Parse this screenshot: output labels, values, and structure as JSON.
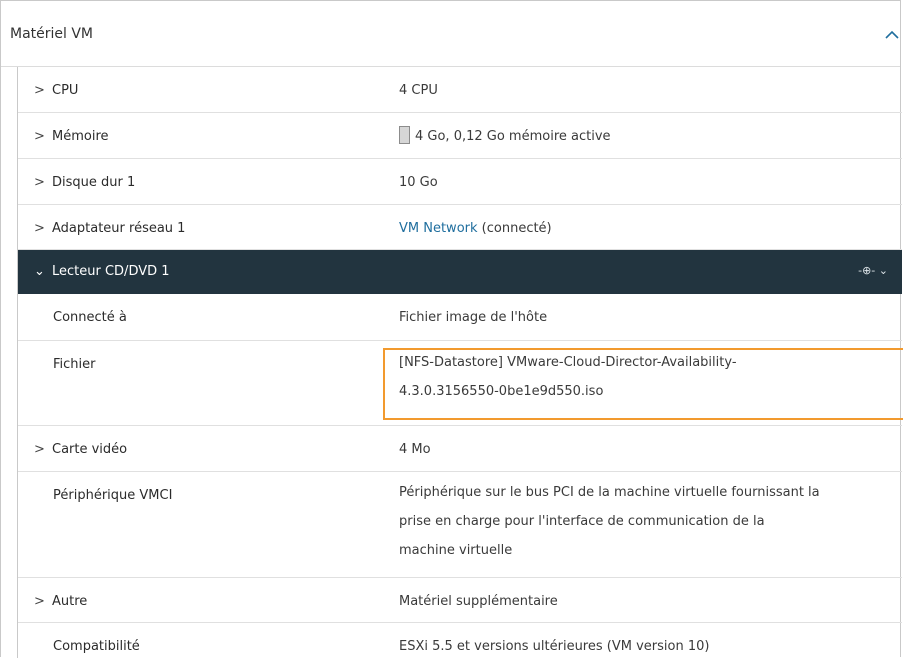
{
  "header": {
    "title": "Matériel VM"
  },
  "rows": {
    "cpu": {
      "label": "CPU",
      "value": "4 CPU"
    },
    "memory": {
      "label": "Mémoire",
      "value": "4 Go, 0,12 Go mémoire active"
    },
    "disk": {
      "label": "Disque dur 1",
      "value": "10 Go"
    },
    "network": {
      "label": "Adaptateur réseau 1",
      "value_link": "VM Network",
      "value_suffix": " (connecté)"
    },
    "cddvd": {
      "label": "Lecteur CD/DVD 1",
      "connected_label": "Connecté à",
      "connected_value": "Fichier image de l'hôte",
      "file_label": "Fichier",
      "file_line1": "[NFS-Datastore] VMware-Cloud-Director-Availability-",
      "file_line2": "4.3.0.3156550-0be1e9d550.iso"
    },
    "video": {
      "label": "Carte vidéo",
      "value": "4 Mo"
    },
    "vmci": {
      "label": "Périphérique VMCI",
      "line1": "Périphérique sur le bus PCI de la machine virtuelle fournissant la",
      "line2": "prise en charge pour l'interface de communication de la",
      "line3": "machine virtuelle"
    },
    "other": {
      "label": "Autre",
      "value": "Matériel supplémentaire"
    },
    "compat": {
      "label": "Compatibilité",
      "value": "ESXi 5.5 et versions ultérieures (VM version 10)"
    }
  },
  "icons": {
    "expand": "chevron-right-icon",
    "expanded": "chevron-down-icon",
    "collapse": "chevron-up-icon",
    "connection": "connection-icon"
  },
  "colors": {
    "dark_row": "#22343f",
    "highlight": "#f29a2e",
    "link": "#1f6e9e"
  }
}
